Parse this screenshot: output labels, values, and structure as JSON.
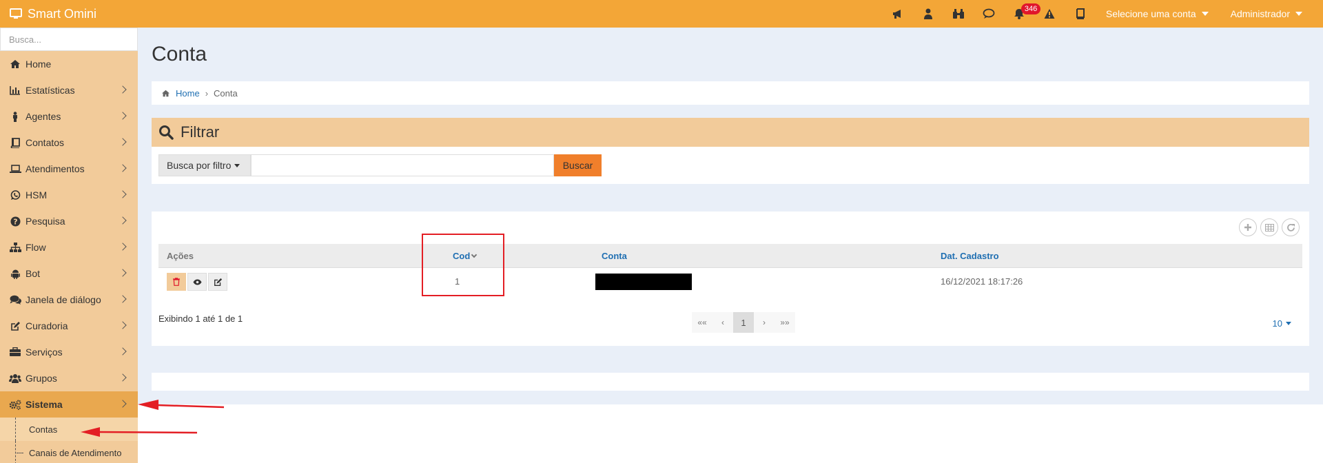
{
  "app": {
    "title": "Smart Omini"
  },
  "topbar": {
    "icons": [
      "bullhorn-icon",
      "user-icon",
      "binoculars-icon",
      "comment-icon",
      "bell-icon",
      "warning-icon",
      "book-icon"
    ],
    "notification_count": "346",
    "account_select": "Selecione uma conta",
    "user_menu": "Administrador"
  },
  "sidebar": {
    "search_placeholder": "Busca...",
    "items": [
      {
        "label": "Home",
        "icon": "home-icon"
      },
      {
        "label": "Estatísticas",
        "icon": "bar-chart-icon"
      },
      {
        "label": "Agentes",
        "icon": "person-icon"
      },
      {
        "label": "Contatos",
        "icon": "address-book-icon"
      },
      {
        "label": "Atendimentos",
        "icon": "laptop-icon"
      },
      {
        "label": "HSM",
        "icon": "whatsapp-icon"
      },
      {
        "label": "Pesquisa",
        "icon": "question-icon"
      },
      {
        "label": "Flow",
        "icon": "sitemap-icon"
      },
      {
        "label": "Bot",
        "icon": "android-icon"
      },
      {
        "label": "Janela de diálogo",
        "icon": "comments-icon"
      },
      {
        "label": "Curadoria",
        "icon": "edit-icon"
      },
      {
        "label": "Serviços",
        "icon": "briefcase-icon"
      },
      {
        "label": "Grupos",
        "icon": "users-icon"
      },
      {
        "label": "Sistema",
        "icon": "gears-icon"
      }
    ],
    "sub_items": [
      {
        "label": "Contas"
      },
      {
        "label": "Canais de Atendimento"
      }
    ]
  },
  "main": {
    "title": "Conta",
    "breadcrumb": {
      "home": "Home",
      "current": "Conta"
    },
    "filter": {
      "title": "Filtrar",
      "dropdown_label": "Busca por filtro",
      "input_value": "",
      "button_label": "Buscar"
    },
    "table": {
      "columns": [
        "Ações",
        "Cod",
        "Conta",
        "Dat. Cadastro"
      ],
      "rows": [
        {
          "cod": "1",
          "conta": "",
          "date": "16/12/2021 18:17:26"
        }
      ],
      "showing": "Exibindo 1 até 1 de 1",
      "pagination": [
        "««",
        "‹",
        "1",
        "›",
        "»»"
      ],
      "per_page": "10"
    }
  },
  "colors": {
    "topbar": "#f3a637",
    "sidebar": "#f2cb9a",
    "sidebar_active": "#e9a84f",
    "content_bg": "#e9eff8",
    "search_button": "#f07f2b",
    "link": "#1f6fb2",
    "annotation": "#e31e24"
  }
}
